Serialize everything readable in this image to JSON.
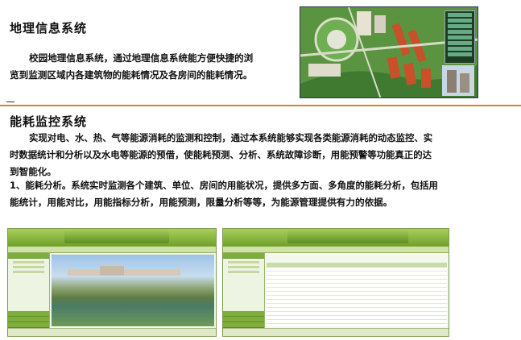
{
  "sections": {
    "gis": {
      "title": "地理信息系统",
      "body_line1": "校园地理信息系统，通过地理信息系统能方便快捷的浏",
      "body_line2": "览到监测区域内各建筑物的能耗情况及各房间的能耗情况。"
    },
    "energy": {
      "title": "能耗监控系统",
      "p1_line1": "实现对电、水、热、气等能源消耗的监测和控制，通过本系统能够实现各类能源消耗的动态监控、实",
      "p1_line2": "时数据统计和分析以及水电等能源的预借，使能耗预测、分析、系统故障诊断，用能预警等功能真正的达",
      "p1_line3": "到智能化。",
      "p2_line1": "1、能耗分析。系统实时监测各个建筑、单位、房间的用能状况，提供多方面、多角度的能耗分析，包括用",
      "p2_line2": "能统计，用能对比，用能指标分析，用能预测，限量分析等等，为能源管理提供有力的依据。"
    }
  },
  "colors": {
    "rule": "#e08020",
    "ui_green": "#7fae3d"
  },
  "thumbnails": {
    "map_alt": "campus-gis-map",
    "shot_left_alt": "energy-monitor-campus-photo",
    "shot_right_alt": "energy-monitor-data-table"
  }
}
